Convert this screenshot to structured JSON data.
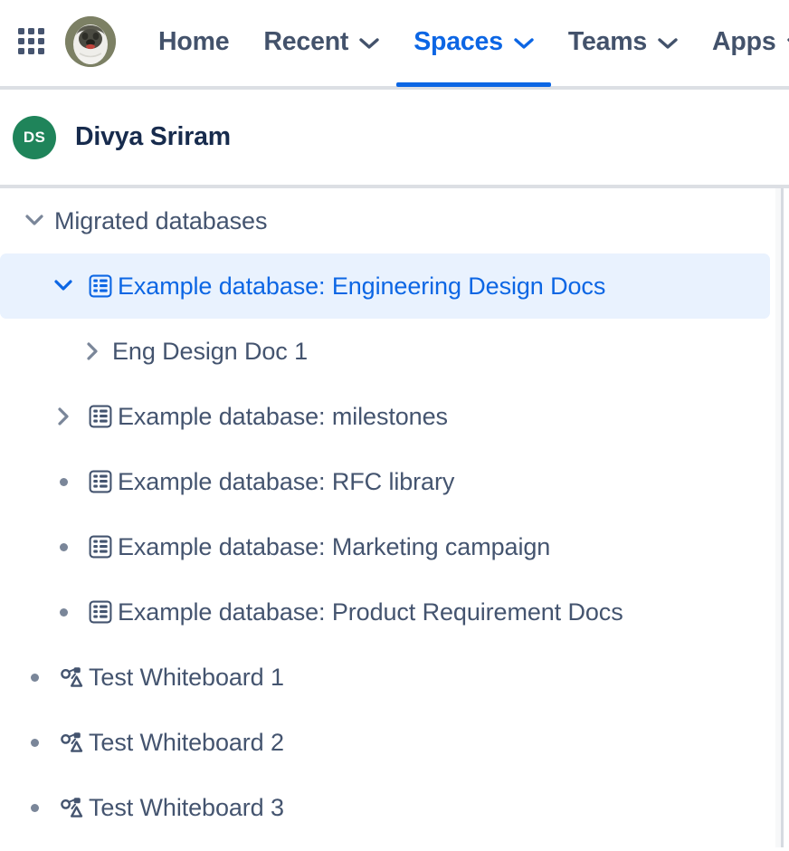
{
  "topnav": {
    "app_switcher_icon": "grid-icon",
    "avatar_icon": "user-profile-photo",
    "items": [
      {
        "label": "Home",
        "has_chevron": false,
        "active": false
      },
      {
        "label": "Recent",
        "has_chevron": true,
        "active": false
      },
      {
        "label": "Spaces",
        "has_chevron": true,
        "active": true
      },
      {
        "label": "Teams",
        "has_chevron": true,
        "active": false
      },
      {
        "label": "Apps",
        "has_chevron": true,
        "active": false
      }
    ],
    "active_color": "#0c66e4",
    "text_color": "#43526b"
  },
  "space_header": {
    "avatar_initials": "DS",
    "avatar_color": "#1f845a",
    "name": "Divya Sriram"
  },
  "tree": {
    "selected_background": "#e9f2fe",
    "selected_text_color": "#0c66e4",
    "default_text_color": "#44546f",
    "rows": [
      {
        "label": "Migrated databases",
        "indent": 1,
        "twisty": "chevron-down",
        "icon": "none",
        "selected": false
      },
      {
        "label": "Example database: Engineering Design Docs",
        "indent": 2,
        "twisty": "chevron-down",
        "icon": "database-icon",
        "selected": true
      },
      {
        "label": "Eng Design Doc 1",
        "indent": 3,
        "twisty": "chevron-right",
        "icon": "none",
        "selected": false
      },
      {
        "label": "Example database: milestones",
        "indent": 2,
        "twisty": "chevron-right",
        "icon": "database-icon",
        "selected": false
      },
      {
        "label": "Example database: RFC library",
        "indent": 2,
        "twisty": "bullet",
        "icon": "database-icon",
        "selected": false
      },
      {
        "label": "Example database: Marketing campaign",
        "indent": 2,
        "twisty": "bullet",
        "icon": "database-icon",
        "selected": false
      },
      {
        "label": "Example database: Product Requirement Docs",
        "indent": 2,
        "twisty": "bullet",
        "icon": "database-icon",
        "selected": false
      },
      {
        "label": "Test Whiteboard 1",
        "indent": 1,
        "twisty": "bullet",
        "icon": "whiteboard-icon",
        "selected": false
      },
      {
        "label": "Test Whiteboard 2",
        "indent": 1,
        "twisty": "bullet",
        "icon": "whiteboard-icon",
        "selected": false
      },
      {
        "label": "Test Whiteboard 3",
        "indent": 1,
        "twisty": "bullet",
        "icon": "whiteboard-icon",
        "selected": false
      }
    ]
  }
}
